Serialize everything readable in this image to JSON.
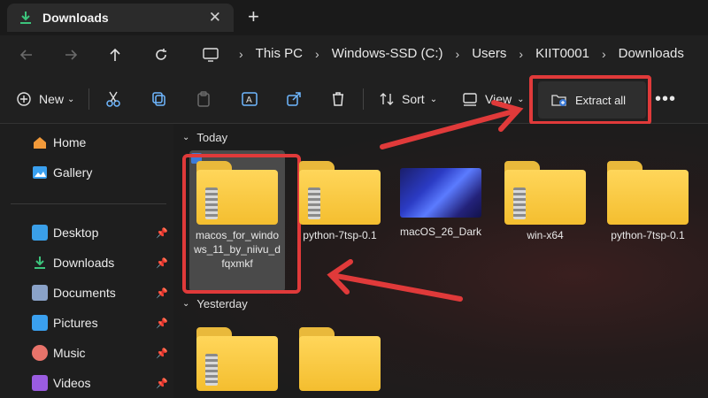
{
  "tab": {
    "title": "Downloads"
  },
  "breadcrumb": [
    "This PC",
    "Windows-SSD (C:)",
    "Users",
    "KIIT0001",
    "Downloads"
  ],
  "toolbar": {
    "new_label": "New",
    "sort_label": "Sort",
    "view_label": "View",
    "extract_label": "Extract all"
  },
  "sidebar": {
    "top": [
      {
        "label": "Home",
        "icon": "home-icon"
      },
      {
        "label": "Gallery",
        "icon": "gallery-icon"
      }
    ],
    "pinned": [
      {
        "label": "Desktop",
        "icon": "desktop-icon"
      },
      {
        "label": "Downloads",
        "icon": "download-icon"
      },
      {
        "label": "Documents",
        "icon": "documents-icon"
      },
      {
        "label": "Pictures",
        "icon": "pictures-icon"
      },
      {
        "label": "Music",
        "icon": "music-icon"
      },
      {
        "label": "Videos",
        "icon": "videos-icon"
      }
    ]
  },
  "groups": {
    "today": "Today",
    "yesterday": "Yesterday"
  },
  "files_today": [
    {
      "name": "macos_for_windows_11_by_niivu_dfqxmkf",
      "name_lines": [
        "macos_for_windo",
        "ws_11_by_niivu_d",
        "fqxmkf"
      ],
      "type": "zip-folder"
    },
    {
      "name": "python-7tsp-0.1",
      "type": "zip-folder"
    },
    {
      "name": "macOS_26_Dark",
      "type": "image"
    },
    {
      "name": "win-x64",
      "type": "zip-folder"
    },
    {
      "name": "python-7tsp-0.1",
      "type": "folder"
    }
  ],
  "files_yesterday": [
    {
      "name": "",
      "type": "zip-folder"
    },
    {
      "name": "",
      "type": "folder"
    }
  ],
  "colors": {
    "highlight": "#e03a3a",
    "folder": "#ffd65a",
    "accent": "#3c7bd8"
  }
}
